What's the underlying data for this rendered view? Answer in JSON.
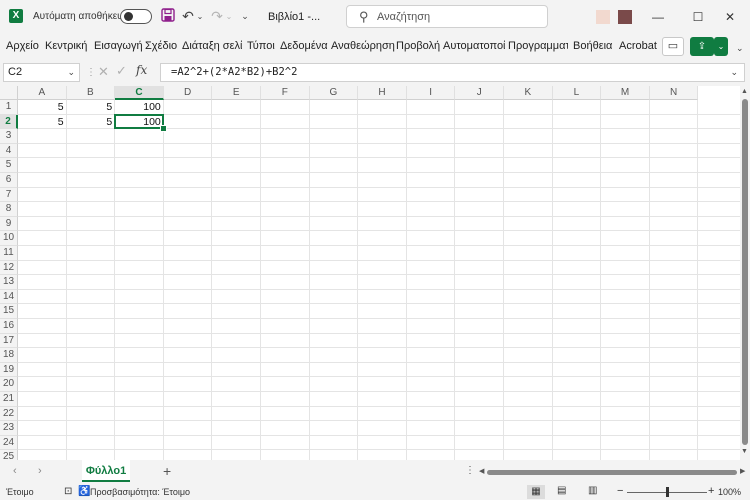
{
  "titlebar": {
    "app_icon_letter": "X",
    "autosave_label": "Αυτόματη αποθήκευση",
    "autosave_on": false,
    "doc_title": "Βιβλίο1 -...",
    "search_placeholder": "Αναζήτηση",
    "icons": [
      "excel-logo-icon",
      "save-icon",
      "undo-icon",
      "redo-icon",
      "customize-qat-icon",
      "search-icon",
      "minimize-icon",
      "maximize-icon",
      "close-icon"
    ],
    "avatar_colors": [
      "#f2d9cf",
      "#7a4a4a",
      "#c9a79f"
    ]
  },
  "ribbon": {
    "tabs": [
      "Αρχείο",
      "Κεντρική",
      "Εισαγωγή",
      "Σχέδιο",
      "Διάταξη σελίδ",
      "Τύποι",
      "Δεδομένα",
      "Αναθεώρηση",
      "Προβολή",
      "Αυτοματοποί",
      "Προγραμματ",
      "Βοήθεια",
      "Acrobat"
    ],
    "accent": "#107c41"
  },
  "formula_bar": {
    "name_box": "C2",
    "fx_label": "fx",
    "formula": "=A2^2+(2*A2*B2)+B2^2"
  },
  "grid": {
    "columns": [
      "A",
      "B",
      "C",
      "D",
      "E",
      "F",
      "G",
      "H",
      "I",
      "J",
      "K",
      "L",
      "M",
      "N"
    ],
    "rows": [
      "1",
      "2",
      "3",
      "4",
      "5",
      "6",
      "7",
      "8",
      "9",
      "10",
      "11",
      "12",
      "13",
      "14",
      "15",
      "16",
      "17",
      "18",
      "19",
      "20",
      "21",
      "22",
      "23",
      "24",
      "25"
    ],
    "selected_column": "C",
    "selected_row": "2",
    "cells": {
      "A1": "5",
      "B1": "5",
      "C1": "100",
      "A2": "5",
      "B2": "5",
      "C2": "100"
    }
  },
  "sheets": {
    "tabs": [
      "Φύλλο1"
    ],
    "active": "Φύλλο1",
    "add_label": "+"
  },
  "statusbar": {
    "ready": "Έτοιμο",
    "accessibility": "Προσβασιμότητα: Έτοιμο",
    "zoom": "100%"
  }
}
